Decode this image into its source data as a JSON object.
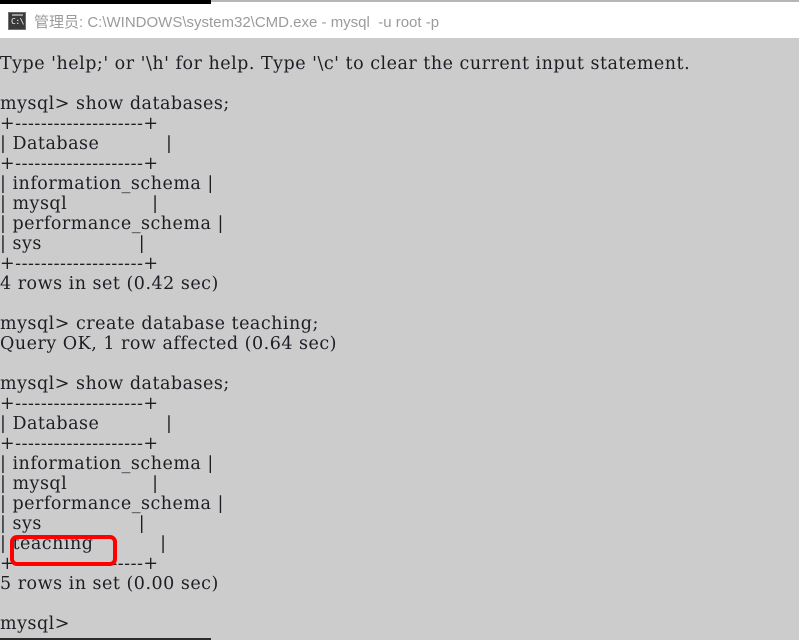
{
  "window": {
    "title": "管理员: C:\\WINDOWS\\system32\\CMD.exe - mysql  -u root -p",
    "icon_name": "cmd-console-icon",
    "icon_glyph": "C:\\",
    "background_color": "#cccccc",
    "titlebar_color": "#ffffff",
    "text_color": "#1d1d24",
    "title_color": "#9b9b9b"
  },
  "console": {
    "lines": [
      "Type 'help;' or '\\h' for help. Type '\\c' to clear the current input statement.",
      "",
      "mysql> show databases;",
      "+--------------------+",
      "| Database           |",
      "+--------------------+",
      "| information_schema |",
      "| mysql              |",
      "| performance_schema |",
      "| sys                |",
      "+--------------------+",
      "4 rows in set (0.42 sec)",
      "",
      "mysql> create database teaching;",
      "Query OK, 1 row affected (0.64 sec)",
      "",
      "mysql> show databases;",
      "+--------------------+",
      "| Database           |",
      "+--------------------+",
      "| information_schema |",
      "| mysql              |",
      "| performance_schema |",
      "| sys                |",
      "| teaching           |",
      "+--------------------+",
      "5 rows in set (0.00 sec)",
      "",
      "mysql>"
    ]
  },
  "annotation": {
    "highlight_label": "teaching",
    "highlight_color": "#ff0000",
    "highlight_shape": "rounded-rectangle"
  }
}
